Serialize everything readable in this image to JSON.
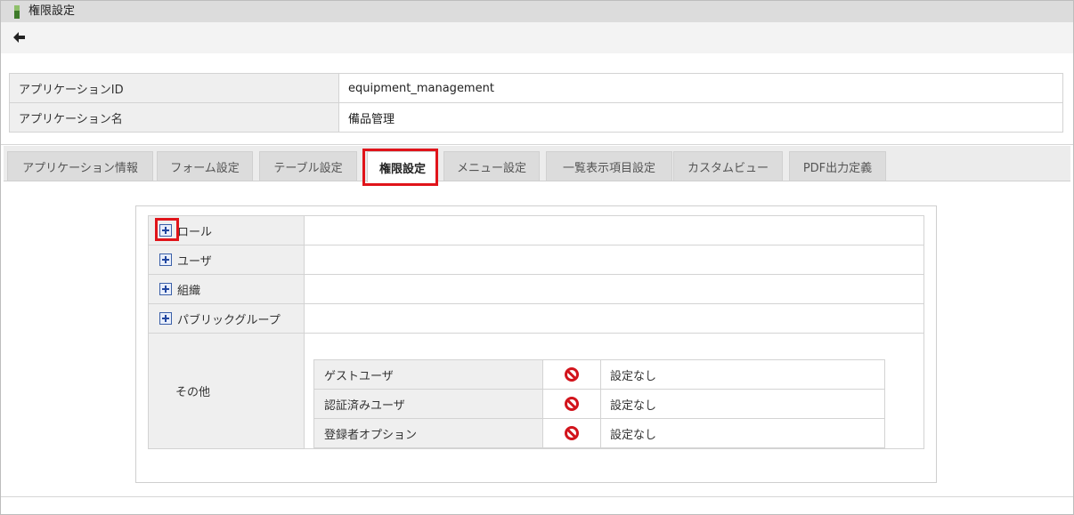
{
  "window": {
    "title": "権限設定"
  },
  "app_info": [
    {
      "label": "アプリケーションID",
      "value": "equipment_management"
    },
    {
      "label": "アプリケーション名",
      "value": "備品管理"
    }
  ],
  "tabs": [
    "アプリケーション情報",
    "フォーム設定",
    "テーブル設定",
    "権限設定",
    "メニュー設定",
    "一覧表示項目設定",
    "カスタムビュー",
    "PDF出力定義"
  ],
  "active_tab": "権限設定",
  "permissions": {
    "groups": [
      "ロール",
      "ユーザ",
      "組織",
      "パブリックグループ"
    ],
    "other_label": "その他",
    "other_rows": [
      {
        "name": "ゲストユーザ",
        "icon": "deny-icon",
        "status": "設定なし"
      },
      {
        "name": "認証済みユーザ",
        "icon": "deny-icon",
        "status": "設定なし"
      },
      {
        "name": "登録者オプション",
        "icon": "deny-icon",
        "status": "設定なし"
      }
    ]
  },
  "colors": {
    "highlight": "#e0141a",
    "deny": "#d2141c",
    "expand_icon": "#2146a0"
  }
}
